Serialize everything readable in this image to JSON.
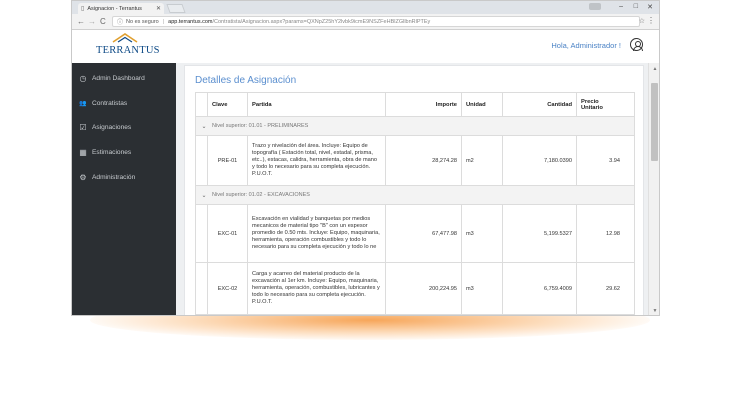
{
  "browser": {
    "tab_title": "Asignacion - Terrantus",
    "tab_close": "✕",
    "security": "No es seguro",
    "url_host": "app.terrantus.com",
    "url_path": "/Contratista/Asignacion.aspx?params=QXNpZ25hY2lvbk9icmE9NSZFeHBlZGllbnRlPTEy"
  },
  "header": {
    "logo_text": "TERRANTUS",
    "greeting": "Hola, Administrador !"
  },
  "sidebar": {
    "items": [
      {
        "label": "Admin Dashboard",
        "icon": "dashboard-icon",
        "glyph": "◷"
      },
      {
        "label": "Contratistas",
        "icon": "users-icon",
        "glyph": "👥"
      },
      {
        "label": "Asignaciones",
        "icon": "checkbox-icon",
        "glyph": "☑"
      },
      {
        "label": "Estimaciones",
        "icon": "table-icon",
        "glyph": "▦"
      },
      {
        "label": "Administración",
        "icon": "gear-icon",
        "glyph": "⚙"
      }
    ]
  },
  "main": {
    "title": "Detalles de Asignación",
    "columns": [
      "Clave",
      "Partida",
      "Importe",
      "Unidad",
      "Cantidad",
      "Precio Unitario"
    ],
    "groups": [
      {
        "label": "Nivel superior: 01.01 - PRELIMINARES",
        "rows": [
          {
            "clave": "PRE-01",
            "partida": "Trazo y nivelación del área. Incluye: Equipo de topografía ( Estación total, nivel, estadal, prisma, etc..), estacas, calidra, herramienta, obra de mano y todo lo necesario para su completa ejecución. P.U.O.T.",
            "importe": "28,274.28",
            "unidad": "m2",
            "cantidad": "7,180.0390",
            "precio": "3.94"
          }
        ]
      },
      {
        "label": "Nivel superior: 01.02 - EXCAVACIONES",
        "rows": [
          {
            "clave": "EXC-01",
            "partida": "Excavación en vialidad y banquetas por medios mecanicos de material tipo \"B\" con un espesor promedio de 0.50 mts. Incluye: Equipo, maquinaria, herramienta, operación combustibles y todo lo necesario para su completa ejecución y todo lo ne",
            "importe": "67,477.98",
            "unidad": "m3",
            "cantidad": "5,199.5327",
            "precio": "12.98"
          },
          {
            "clave": "EXC-02",
            "partida": "Carga y acarreo del material producto de la excavación al 1er km. Incluye: Equipo, maquinaria, herramienta, operación, combustibles, lubricantes y todo lo necesario para su completa ejecución. P.U.O.T.",
            "importe": "200,224.95",
            "unidad": "m3",
            "cantidad": "6,759.4009",
            "precio": "29.62"
          }
        ]
      }
    ]
  },
  "colors": {
    "sidebar_bg": "#2b2f33",
    "accent_blue": "#5b8fcf",
    "logo_blue": "#0e4a86",
    "logo_gold": "#e0a030"
  }
}
